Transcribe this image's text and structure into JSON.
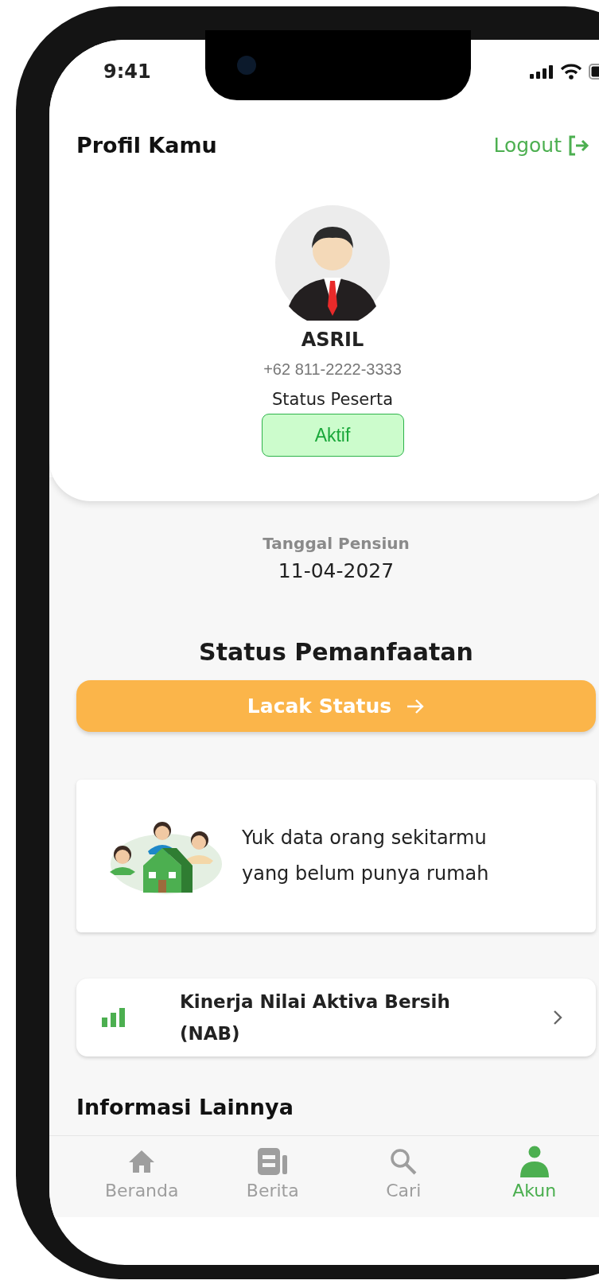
{
  "status_bar": {
    "time": "9:41"
  },
  "header": {
    "title": "Profil Kamu",
    "logout": "Logout"
  },
  "profile": {
    "name": "ASRIL",
    "phone": "+62 811-2222-3333",
    "status_label": "Status Peserta",
    "status": "Aktif"
  },
  "retirement": {
    "label": "Tanggal Pensiun",
    "date": "11-04-2027"
  },
  "benefit": {
    "title": "Status Pemanfaatan",
    "button": "Lacak Status"
  },
  "promo": {
    "text": "Yuk data orang sekitarmu yang belum punya rumah"
  },
  "menu_items": [
    {
      "label": "Kinerja Nilai Aktiva Bersih (NAB)"
    }
  ],
  "section_title": "Informasi Lainnya",
  "nav": [
    {
      "label": "Beranda",
      "kind": "home",
      "selected": false
    },
    {
      "label": "Berita",
      "kind": "news",
      "selected": false
    },
    {
      "label": "Cari",
      "kind": "search",
      "selected": false
    },
    {
      "label": "Akun",
      "kind": "account",
      "selected": true
    }
  ]
}
